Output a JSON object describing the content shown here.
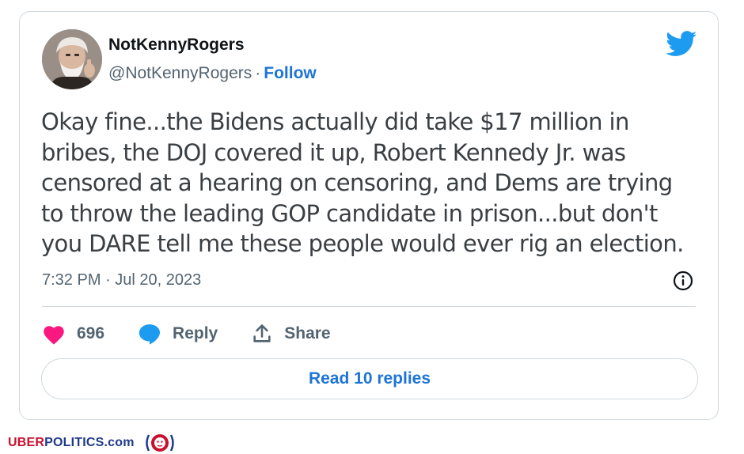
{
  "tweet": {
    "author_name": "NotKennyRogers",
    "handle": "@NotKennyRogers",
    "separator": "·",
    "follow_label": "Follow",
    "text_lines": [
      "Okay fine...the Bidens actually did take $17 million in",
      "bribes, the DOJ covered it up, Robert Kennedy Jr. was",
      "censored at a hearing on censoring, and Dems are trying",
      "to throw the leading GOP candidate in prison...but don't",
      "you DARE tell me these people would ever rig an election."
    ],
    "timestamp": "7:32 PM · Jul 20, 2023",
    "like_count": "696",
    "reply_label": "Reply",
    "share_label": "Share",
    "read_replies_label": "Read 10 replies"
  },
  "icons": {
    "platform": "twitter-bird-icon",
    "info": "info-icon",
    "like": "heart-icon",
    "reply": "speech-bubble-icon",
    "share": "share-upload-icon"
  },
  "colors": {
    "accent_blue": "#1d74d6",
    "twitter_blue": "#1d9bf0",
    "heart_pink": "#f91880",
    "muted_text": "#536471",
    "border": "#cfd9de",
    "brand_red": "#c8102e",
    "brand_navy": "#1f3a8a"
  },
  "footer": {
    "brand_part1": "UBER",
    "brand_part2": "POLITICS",
    "brand_part3": ".com"
  }
}
